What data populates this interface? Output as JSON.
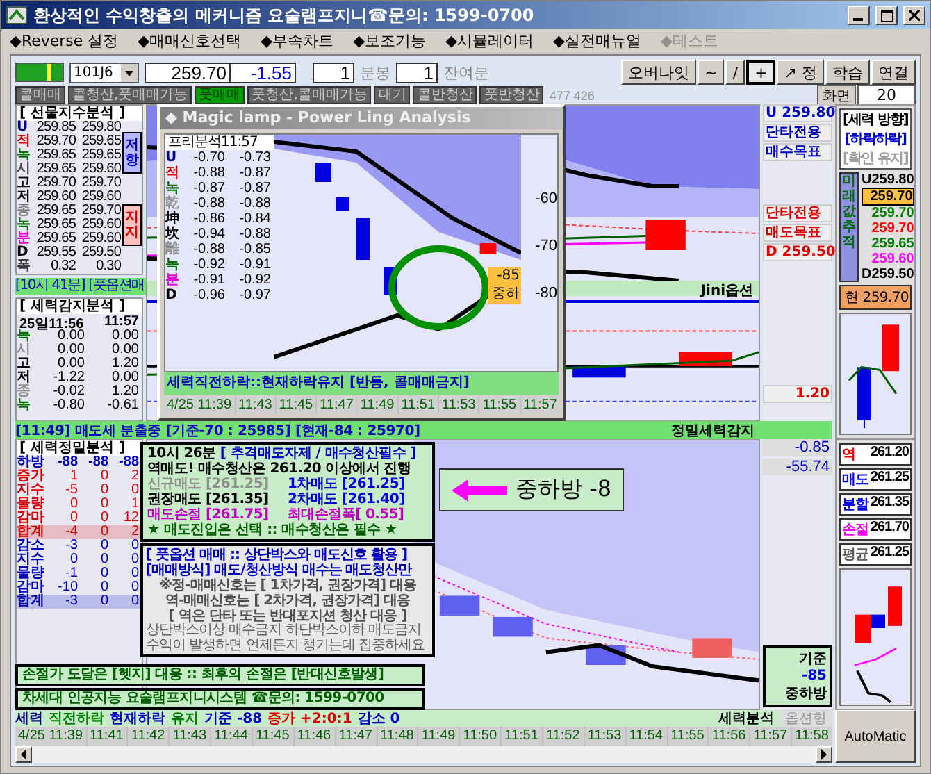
{
  "window": {
    "title": "환상적인 수익창출의 메커니즘 요술램프지니☎문의: 1599-0700"
  },
  "menu": [
    {
      "label": "◆Reverse 설정",
      "disabled": false
    },
    {
      "label": "◆매매신호선택",
      "disabled": false
    },
    {
      "label": "◆부속차트",
      "disabled": false
    },
    {
      "label": "◆보조기능",
      "disabled": false
    },
    {
      "label": "◆시뮬레이터",
      "disabled": false
    },
    {
      "label": "◆실전매뉴얼",
      "disabled": false
    },
    {
      "label": "◆테스트",
      "disabled": true
    }
  ],
  "toolbar": {
    "code": "101J6",
    "price": "259.70",
    "change": "-1.55",
    "interval": "1",
    "interval_label": "분봉",
    "remaining": "1",
    "remaining_label": "잔여분",
    "tools": [
      {
        "label": "오버나잇",
        "selected": false
      },
      {
        "label": "~",
        "selected": false
      },
      {
        "label": "/",
        "selected": false
      },
      {
        "label": "+",
        "selected": true
      },
      {
        "label": "↗ 정",
        "selected": false
      },
      {
        "label": "학습",
        "selected": false
      },
      {
        "label": "연결",
        "selected": false
      }
    ]
  },
  "modes": {
    "items": [
      {
        "label": "콜매매",
        "selected": false
      },
      {
        "label": "콜청산,풋매매가능",
        "selected": false
      },
      {
        "label": "풋매매",
        "selected": true
      },
      {
        "label": "풋청산,콜매매가능",
        "selected": false
      },
      {
        "label": "대기",
        "selected": false
      },
      {
        "label": "콜반청산",
        "selected": false
      },
      {
        "label": "풋반청산",
        "selected": false
      }
    ],
    "counter": "477 426"
  },
  "screen": {
    "label": "화면",
    "value": "20"
  },
  "futures_analysis": {
    "title": "[ 선물지수분석 ]",
    "resistance": "저항",
    "support": "지지",
    "rows": [
      {
        "label": "U",
        "values": [
          "259.85",
          "259.80"
        ],
        "color": "#000090"
      },
      {
        "label": "적",
        "values": [
          "259.70",
          "259.65"
        ],
        "color": "#e00000"
      },
      {
        "label": "녹",
        "values": [
          "259.65",
          "259.65"
        ],
        "color": "#007000"
      },
      {
        "label": "시",
        "values": [
          "259.65",
          "259.60"
        ],
        "color": "#505050"
      },
      {
        "label": "고",
        "values": [
          "259.70",
          "259.70"
        ],
        "color": "#000000"
      },
      {
        "label": "저",
        "values": [
          "259.60",
          "259.60"
        ],
        "color": "#000000"
      },
      {
        "label": "종",
        "values": [
          "259.65",
          "259.70"
        ],
        "color": "#808080"
      },
      {
        "label": "녹",
        "values": [
          "259.65",
          "259.60"
        ],
        "color": "#007000"
      },
      {
        "label": "분",
        "values": [
          "259.65",
          "259.60"
        ],
        "color": "#e000e0"
      },
      {
        "label": "D",
        "values": [
          "259.55",
          "259.50"
        ],
        "color": "#000000"
      },
      {
        "label": "폭",
        "values": [
          "0.32",
          "0.30"
        ],
        "color": "#404040"
      }
    ]
  },
  "notice": "[10시 41분] [풋옵션매",
  "force_detect": {
    "title": "[ 세력감지분석 ]",
    "header": [
      "25일11:56",
      "11:57"
    ],
    "rows": [
      {
        "label": "녹",
        "values": [
          "0.00",
          "0.00"
        ],
        "color": "#007000"
      },
      {
        "label": "시",
        "values": [
          "0.00",
          "0.00"
        ],
        "color": "#909090"
      },
      {
        "label": "고",
        "values": [
          "0.00",
          "1.20"
        ],
        "color": "#000000"
      },
      {
        "label": "저",
        "values": [
          "-1.22",
          "0.00"
        ],
        "color": "#000000"
      },
      {
        "label": "종",
        "values": [
          "-0.02",
          "1.20"
        ],
        "color": "#909090"
      },
      {
        "label": "녹",
        "values": [
          "-0.80",
          "-0.61"
        ],
        "color": "#007000"
      }
    ]
  },
  "status": {
    "message": "[11:49] 매도세 분출중 [기준-70 : 25985] [현재-84 : 25970]",
    "label": "정밀세력감지"
  },
  "upper_chart": {
    "top_labels": [
      "U 259.80",
      "단타전용",
      "매수목표"
    ],
    "bottom_labels": [
      "단타전용",
      "매도목표",
      "D 259.50"
    ],
    "series_label": "Jini옵션",
    "reading": "1.20"
  },
  "direction": {
    "title": "[세력 방향]",
    "lines": [
      "[하락하락]",
      "[확인 유지]"
    ],
    "track_label": "미래값추적",
    "current": "현 259.70",
    "values": [
      {
        "text": "U259.80",
        "color": "#000000",
        "selected": false
      },
      {
        "text": "259.70",
        "color": "#000000",
        "selected": true
      },
      {
        "text": "259.70",
        "color": "#008000",
        "selected": false
      },
      {
        "text": "259.70",
        "color": "#ff0000",
        "selected": false
      },
      {
        "text": "259.65",
        "color": "#008000",
        "selected": false
      },
      {
        "text": "259.60",
        "color": "#ff00ff",
        "selected": false
      },
      {
        "text": "D259.50",
        "color": "#000000",
        "selected": false
      }
    ]
  },
  "lamp": {
    "title": "◆ Magic lamp - Power Ling Analysis",
    "table_title": "프리분석11:57",
    "axis": [
      "-60",
      "-70",
      "-80"
    ],
    "marker": [
      "-85",
      "중하"
    ],
    "message": "세력직전하락::현재하락유지 [반등, 콜매매금지]",
    "rows": [
      {
        "label": "U",
        "values": [
          "-0.70",
          "-0.73"
        ],
        "color": "#000090"
      },
      {
        "label": "적",
        "values": [
          "-0.88",
          "-0.87"
        ],
        "color": "#e00000"
      },
      {
        "label": "녹",
        "values": [
          "-0.87",
          "-0.87"
        ],
        "color": "#007000"
      },
      {
        "label": "乾",
        "values": [
          "-0.88",
          "-0.88"
        ],
        "color": "#909090"
      },
      {
        "label": "坤",
        "values": [
          "-0.86",
          "-0.84"
        ],
        "color": "#000000"
      },
      {
        "label": "坎",
        "values": [
          "-0.94",
          "-0.88"
        ],
        "color": "#000000"
      },
      {
        "label": "離",
        "values": [
          "-0.88",
          "-0.85"
        ],
        "color": "#909090"
      },
      {
        "label": "녹",
        "values": [
          "-0.92",
          "-0.91"
        ],
        "color": "#007000"
      },
      {
        "label": "분",
        "values": [
          "-0.91",
          "-0.92"
        ],
        "color": "#e000e0"
      },
      {
        "label": "D",
        "values": [
          "-0.96",
          "-0.97"
        ],
        "color": "#000000"
      }
    ],
    "times": [
      "4/25 11:39",
      "11:43",
      "11:45",
      "11:47",
      "11:49",
      "11:51",
      "11:53",
      "11:55",
      "11:57"
    ]
  },
  "precision": {
    "title": "[ 세력정밀분석 ]",
    "header": [
      "하방",
      "-88",
      "-88",
      "-88"
    ],
    "rows": [
      {
        "label": "증가",
        "values": [
          "1",
          "0",
          "2"
        ],
        "color": "#e00000",
        "kind": "item"
      },
      {
        "label": "지수",
        "values": [
          "-5",
          "0",
          "0"
        ],
        "color": "#e00000",
        "kind": "item"
      },
      {
        "label": "물량",
        "values": [
          "0",
          "0",
          "1"
        ],
        "color": "#e00000",
        "kind": "item"
      },
      {
        "label": "감마",
        "values": [
          "0",
          "0",
          "12"
        ],
        "color": "#e00000",
        "kind": "item"
      },
      {
        "label": "합계",
        "values": [
          "-4",
          "0",
          "2"
        ],
        "color": "#e00000",
        "kind": "total"
      },
      {
        "label": "감소",
        "values": [
          "-3",
          "0",
          "0"
        ],
        "color": "#0000c0",
        "kind": "item"
      },
      {
        "label": "지수",
        "values": [
          "0",
          "0",
          "0"
        ],
        "color": "#0000c0",
        "kind": "item"
      },
      {
        "label": "물량",
        "values": [
          "-1",
          "0",
          "0"
        ],
        "color": "#0000c0",
        "kind": "item"
      },
      {
        "label": "감마",
        "values": [
          "-10",
          "0",
          "0"
        ],
        "color": "#0000c0",
        "kind": "item"
      },
      {
        "label": "합계",
        "values": [
          "-3",
          "0",
          "0"
        ],
        "color": "#0000c0",
        "kind": "total"
      }
    ]
  },
  "advice": {
    "time": "10시 26분",
    "headline": "[ 추격매도자제 / 매수청산필수 ]",
    "lead": "역매도! 매수청산은 261.20 이상에서 진행",
    "note": "★ 매도진입은 선택 :: 매수청산은 필수 ★",
    "prices": [
      {
        "text": "신규매도 [261.25]",
        "color": "#909090"
      },
      {
        "text": "1차매도 [261.25]",
        "color": "#0000e0"
      },
      {
        "text": "권장매도 [261.35]",
        "color": "#000000"
      },
      {
        "text": "2차매도 [261.40]",
        "color": "#0000e0"
      },
      {
        "text": "매도손절 [261.75]",
        "color": "#c000c0"
      },
      {
        "text": "최대손절폭[ 0.55]",
        "color": "#c000c0"
      }
    ]
  },
  "guide": {
    "title": "[ 풋옵션 매매 :: 상단박스와 매도신호 활용 ]",
    "method": "[매매방식] 매도/청산방식 매수는 매도청산만",
    "rules": [
      "※정-매매신호는 [ 1차가격, 권장가격] 대응",
      "역-매매신호는 [ 2차가격, 권장가격] 대응",
      "[ 역은 단타 또는 반대포지션 청산 대응 ]"
    ],
    "tips": [
      "상단박스이상 매수금지  하단박스이하 매도금지",
      "수익이 발생하면 언제든지 챙기는데 집중하세요"
    ]
  },
  "footer_notes": [
    "손절가 도달은 [헷지] 대응 :: 최후의 손절은 [반대신호발생]",
    "차세대 인공지능 요술램프지니시스템 ☎문의: 1599-0700"
  ],
  "callout": "중하방 -8",
  "lower_chart": {
    "readings": [
      "-0.85",
      "-55.74"
    ],
    "marker": [
      "기준",
      "-85",
      "중하방"
    ]
  },
  "targets": [
    {
      "label": "역",
      "value": "261.20",
      "color": "#ff0000"
    },
    {
      "label": "매도",
      "value": "261.25",
      "color": "#0000ff"
    },
    {
      "label": "분할",
      "value": "261.35",
      "color": "#0000ff"
    },
    {
      "label": "손절",
      "value": "261.70",
      "color": "#ff00ff"
    },
    {
      "label": "평균",
      "value": "261.25",
      "color": "#606060"
    }
  ],
  "bottom_status": {
    "items": [
      {
        "text": "세력",
        "color": "#000080"
      },
      {
        "text": "직전하락",
        "color": "#008000"
      },
      {
        "text": "현재하락",
        "color": "#0000c0"
      },
      {
        "text": "유지",
        "color": "#008000"
      },
      {
        "text": "기준 -88",
        "color": "#0000c0"
      },
      {
        "text": "증가 +2:0:1",
        "color": "#e00000"
      },
      {
        "text": "감소 0",
        "color": "#0000c0"
      }
    ],
    "label": "세력분석",
    "sub_label": "옵션형"
  },
  "times": [
    "4/25 11:39",
    "11:41",
    "11:42",
    "11:43",
    "11:44",
    "11:45",
    "11:46",
    "11:47",
    "11:48",
    "11:49",
    "11:50",
    "11:51",
    "11:52",
    "11:53",
    "11:54",
    "11:55",
    "11:56",
    "11:57",
    "11:58"
  ],
  "auto_button": "AutoMatic"
}
